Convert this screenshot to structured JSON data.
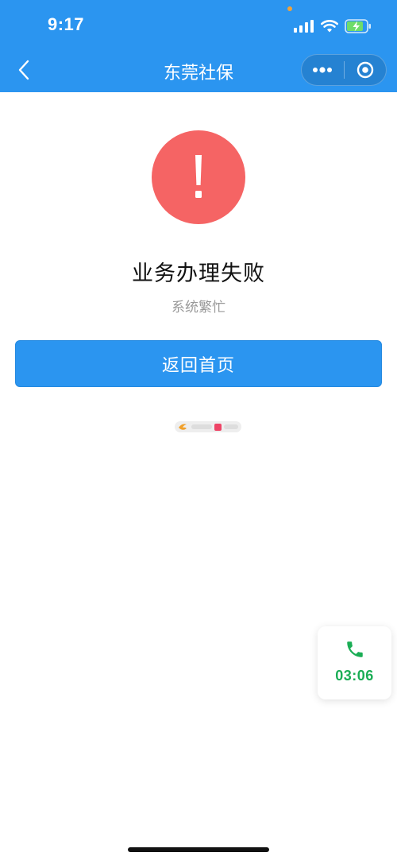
{
  "status_bar": {
    "time": "9:17",
    "icons": [
      "signal-icon",
      "wifi-icon",
      "battery-charging-icon"
    ]
  },
  "nav": {
    "title": "东莞社保",
    "back_icon": "chevron-left-icon",
    "more_icon": "more-dots-icon",
    "close_icon": "target-close-icon"
  },
  "result": {
    "icon": "exclamation-icon",
    "title": "业务办理失败",
    "subtitle": "系统繁忙"
  },
  "actions": {
    "home_button_label": "返回首页"
  },
  "call_widget": {
    "icon": "phone-icon",
    "timer": "03:06"
  },
  "colors": {
    "primary": "#2b95f0",
    "error": "#f56464",
    "call_green": "#1aad55"
  }
}
